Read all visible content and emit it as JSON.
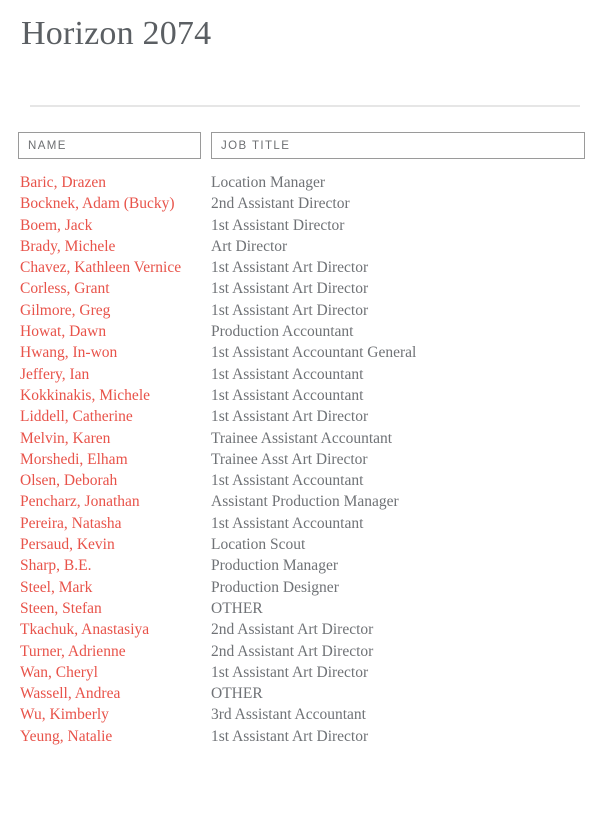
{
  "page": {
    "title": "Horizon 2074"
  },
  "table": {
    "columns": [
      {
        "key": "name",
        "label": "NAME"
      },
      {
        "key": "job_title",
        "label": "JOB TITLE"
      }
    ],
    "rows": [
      {
        "name": "Baric, Drazen",
        "job_title": "Location Manager"
      },
      {
        "name": "Bocknek, Adam (Bucky)",
        "job_title": "2nd Assistant Director"
      },
      {
        "name": "Boem, Jack",
        "job_title": "1st Assistant Director"
      },
      {
        "name": "Brady, Michele",
        "job_title": "Art Director"
      },
      {
        "name": "Chavez, Kathleen Vernice",
        "job_title": "1st Assistant Art Director"
      },
      {
        "name": "Corless, Grant",
        "job_title": "1st Assistant Art Director"
      },
      {
        "name": "Gilmore, Greg",
        "job_title": "1st Assistant Art Director"
      },
      {
        "name": "Howat, Dawn",
        "job_title": "Production Accountant"
      },
      {
        "name": "Hwang, In-won",
        "job_title": "1st Assistant Accountant General"
      },
      {
        "name": "Jeffery, Ian",
        "job_title": "1st Assistant Accountant"
      },
      {
        "name": "Kokkinakis, Michele",
        "job_title": "1st Assistant Accountant"
      },
      {
        "name": "Liddell, Catherine",
        "job_title": "1st Assistant Art Director"
      },
      {
        "name": "Melvin, Karen",
        "job_title": "Trainee Assistant Accountant"
      },
      {
        "name": "Morshedi, Elham",
        "job_title": "Trainee Asst Art Director"
      },
      {
        "name": "Olsen, Deborah",
        "job_title": "1st Assistant Accountant"
      },
      {
        "name": "Pencharz, Jonathan",
        "job_title": "Assistant Production Manager"
      },
      {
        "name": "Pereira, Natasha",
        "job_title": "1st Assistant Accountant"
      },
      {
        "name": "Persaud, Kevin",
        "job_title": "Location Scout"
      },
      {
        "name": "Sharp, B.E.",
        "job_title": "Production Manager"
      },
      {
        "name": "Steel, Mark",
        "job_title": "Production Designer"
      },
      {
        "name": "Steen, Stefan",
        "job_title": "OTHER"
      },
      {
        "name": "Tkachuk, Anastasiya",
        "job_title": "2nd Assistant Art Director"
      },
      {
        "name": "Turner, Adrienne",
        "job_title": "2nd Assistant Art Director"
      },
      {
        "name": "Wan, Cheryl",
        "job_title": "1st Assistant Art Director"
      },
      {
        "name": "Wassell, Andrea",
        "job_title": "OTHER"
      },
      {
        "name": "Wu, Kimberly",
        "job_title": "3rd Assistant Accountant"
      },
      {
        "name": "Yeung, Natalie",
        "job_title": "1st Assistant Art Director"
      }
    ]
  },
  "colors": {
    "name_text": "#e8534a",
    "job_title_text": "#6f7276",
    "title_text": "#5b5f63",
    "header_text": "#6d6f72",
    "header_border": "#9a9a9a",
    "divider": "#e6e6e6",
    "background": "#ffffff"
  }
}
